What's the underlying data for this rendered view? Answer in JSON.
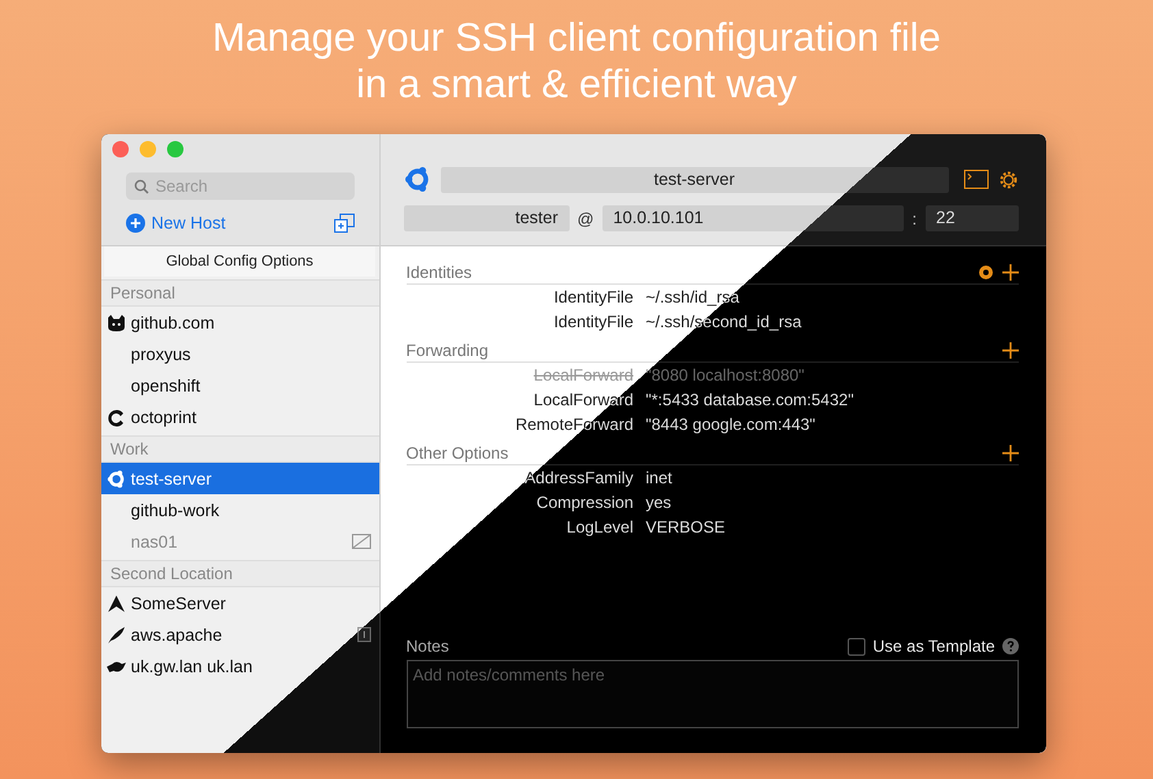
{
  "headline": [
    "Manage your SSH client configuration file",
    "in a smart & efficient way"
  ],
  "sidebar": {
    "search": {
      "placeholder": "Search"
    },
    "new_host": "New Host",
    "global_config": "Global Config Options",
    "groups": [
      {
        "name": "Personal",
        "hosts": [
          {
            "name": "github.com",
            "kind": "cat",
            "selected": false,
            "disabled": false,
            "flagged": false
          },
          {
            "name": "proxyus",
            "kind": "plain",
            "selected": false,
            "disabled": false,
            "flagged": false
          },
          {
            "name": "openshift",
            "kind": "plain",
            "selected": false,
            "disabled": false,
            "flagged": false
          },
          {
            "name": "octoprint",
            "kind": "ring",
            "selected": false,
            "disabled": false,
            "flagged": false
          }
        ]
      },
      {
        "name": "Work",
        "hosts": [
          {
            "name": "test-server",
            "kind": "hub",
            "selected": true,
            "disabled": false,
            "flagged": false
          },
          {
            "name": "github-work",
            "kind": "plain",
            "selected": false,
            "disabled": false,
            "flagged": false
          },
          {
            "name": "nas01",
            "kind": "plain",
            "selected": false,
            "disabled": true,
            "flagged": false
          }
        ]
      },
      {
        "name": "Second Location",
        "hosts": [
          {
            "name": "SomeServer",
            "kind": "peak",
            "selected": false,
            "disabled": false,
            "flagged": false
          },
          {
            "name": "aws.apache",
            "kind": "feather",
            "selected": false,
            "disabled": false,
            "flagged": true
          },
          {
            "name": "uk.gw.lan uk.lan",
            "kind": "bird",
            "selected": false,
            "disabled": false,
            "flagged": false
          }
        ]
      }
    ]
  },
  "host": {
    "name": "test-server",
    "user": "tester",
    "at": "@",
    "hostname": "10.0.10.101",
    "colon": ":",
    "port": "22"
  },
  "sections": [
    {
      "title": "Identities",
      "gear": true,
      "rows": [
        {
          "key": "IdentityFile",
          "value": "~/.ssh/id_rsa",
          "disabled": false
        },
        {
          "key": "IdentityFile",
          "value": "~/.ssh/second_id_rsa",
          "disabled": false
        }
      ]
    },
    {
      "title": "Forwarding",
      "gear": false,
      "rows": [
        {
          "key": "LocalForward",
          "value": "\"8080 localhost:8080\"",
          "disabled": true
        },
        {
          "key": "LocalForward",
          "value": "\"*:5433 database.com:5432\"",
          "disabled": false
        },
        {
          "key": "RemoteForward",
          "value": "\"8443 google.com:443\"",
          "disabled": false
        }
      ]
    },
    {
      "title": "Other Options",
      "gear": false,
      "rows": [
        {
          "key": "AddressFamily",
          "value": "inet",
          "disabled": false
        },
        {
          "key": "Compression",
          "value": "yes",
          "disabled": false
        },
        {
          "key": "LogLevel",
          "value": "VERBOSE",
          "disabled": false
        }
      ]
    }
  ],
  "notes": {
    "label": "Notes",
    "placeholder": "Add notes/comments here",
    "template": {
      "label": "Use as Template",
      "checked": false
    }
  }
}
